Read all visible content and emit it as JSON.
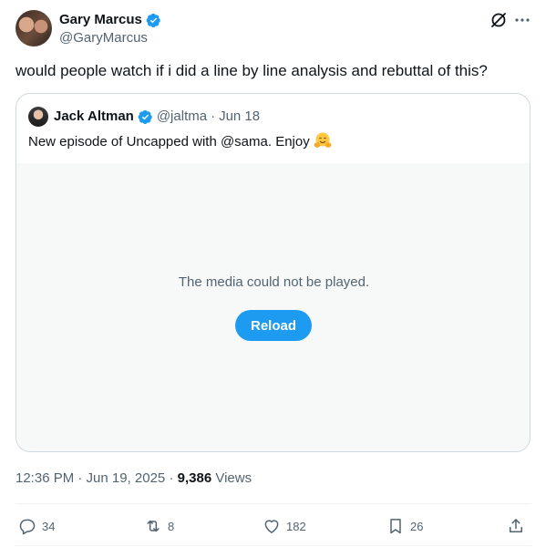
{
  "post": {
    "author_name": "Gary Marcus",
    "author_handle": "@GaryMarcus",
    "text": "would people watch if i did a line by line analysis and rebuttal of this?",
    "timestamp": "12:36 PM · Jun 19, 2025",
    "views_count": "9,386",
    "views_label": "Views"
  },
  "quote": {
    "author_name": "Jack Altman",
    "author_handle": "@jaltma",
    "separator": "·",
    "date": "Jun 18",
    "text": "New episode of Uncapped with @sama. Enjoy",
    "emoji": "hugging-face-emoji",
    "media_error": "The media could not be played.",
    "reload_label": "Reload"
  },
  "actions": {
    "replies": "34",
    "reposts": "8",
    "likes": "182",
    "bookmarks": "26"
  },
  "icons": {
    "verified": "verified-badge-icon",
    "grok": "grok-icon",
    "more": "more-icon",
    "reply": "reply-icon",
    "repost": "repost-icon",
    "like": "heart-icon",
    "bookmark": "bookmark-icon",
    "share": "share-icon"
  },
  "colors": {
    "accent": "#1d9bf0",
    "text_primary": "#0f1419",
    "text_secondary": "#536471",
    "border": "#cfd9de",
    "media_bg": "#f7f9f9"
  }
}
